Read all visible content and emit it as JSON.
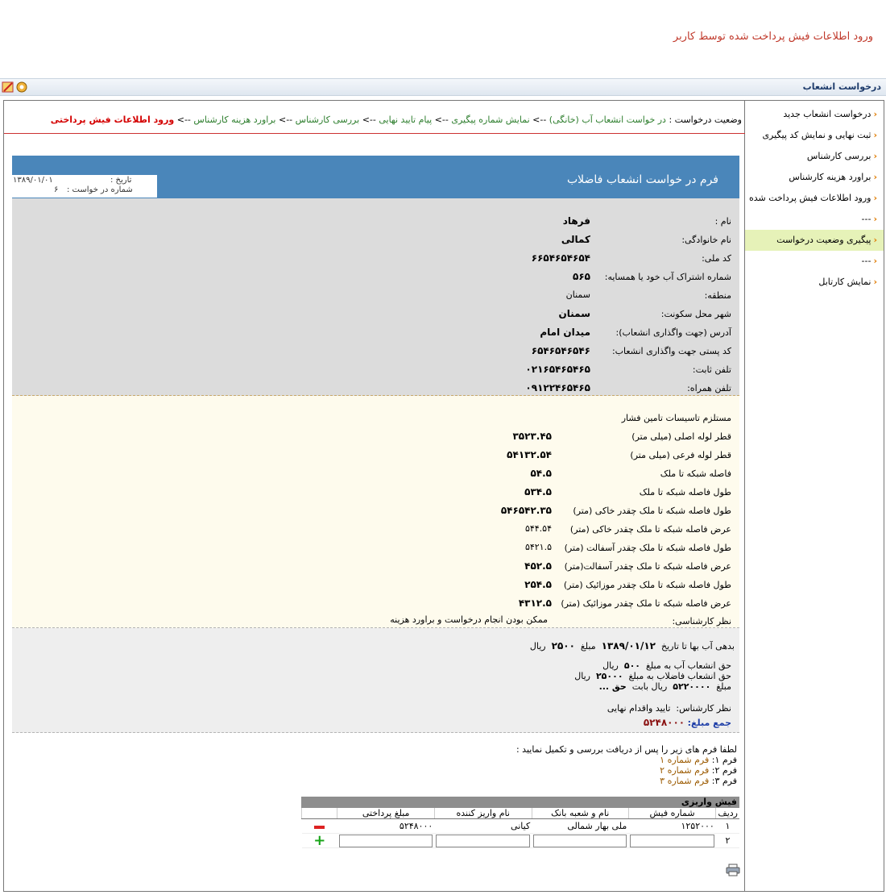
{
  "page_header": "ورود اطلاعات فیش پرداخت شده توسط کاربر",
  "title_bar": "درخواست انشعاب",
  "sidebar": [
    {
      "label": "درخواست انشعاب جدید",
      "active": false
    },
    {
      "label": "ثبت نهایی و نمایش کد پیگیری",
      "active": false
    },
    {
      "label": "بررسی کارشناس",
      "active": false
    },
    {
      "label": "براورد هزینه کارشناس",
      "active": false
    },
    {
      "label": "ورود اطلاعات فیش پرداخت شده",
      "active": false
    },
    {
      "label": "---",
      "active": false
    },
    {
      "label": "پیگیری وضعیت درخواست",
      "active": true
    },
    {
      "label": "---",
      "active": false
    },
    {
      "label": "نمایش کارتابل",
      "active": false
    }
  ],
  "status": {
    "prefix": "وضعیت درخواست :",
    "steps": [
      "در خواست انشعاب آب (خانگی)",
      "نمایش شماره پیگیری",
      "پیام تایید نهایی",
      "بررسی کارشناس",
      "براورد هزینه کارشناس"
    ],
    "separator": "-->",
    "current": "ورود اطلاعات فیش پرداختی"
  },
  "form": {
    "title": "فرم در خواست انشعاب فاضلاب",
    "date_label": "تاریخ :",
    "date_value": "۱۳۸۹/۰۱/۰۱",
    "request_no_label": "شماره در خواست :",
    "request_no_value": "۶"
  },
  "applicant": [
    {
      "label": "نام :",
      "value": "فرهاد",
      "bold": true
    },
    {
      "label": "نام خانوادگی:",
      "value": "کمالی",
      "bold": true
    },
    {
      "label": "کد ملی:",
      "value": "۶۶۵۴۶۵۴۶۵۴",
      "bold": true
    },
    {
      "label": "شماره اشتراک آب خود یا همسایه:",
      "value": "۵۶۵",
      "bold": true
    },
    {
      "label": "منطقه:",
      "value": "سمنان",
      "bold": false
    },
    {
      "label": "شهر محل سکونت:",
      "value": "سمنان",
      "bold": true
    },
    {
      "label": "آدرس (جهت واگذاری انشعاب):",
      "value": "میدان امام",
      "bold": true
    },
    {
      "label": "کد پستی جهت واگذاری انشعاب:",
      "value": "۶۵۴۶۵۴۶۵۴۶",
      "bold": true
    },
    {
      "label": "تلفن ثابت:",
      "value": "۰۲۱۶۵۴۶۵۴۶۵",
      "bold": true
    },
    {
      "label": "تلفن همراه:",
      "value": "۰۹۱۲۲۴۶۵۴۶۵",
      "bold": true
    }
  ],
  "expert_section": {
    "heading": "مستلزم تاسیسات تامین فشار",
    "rows": [
      {
        "label": "قطر لوله اصلی (میلی متر)",
        "value": "۳۵۲۳.۴۵",
        "bold": true
      },
      {
        "label": "قطر لوله فرعی (میلی متر)",
        "value": "۵۴۱۳۲.۵۴",
        "bold": true
      },
      {
        "label": "فاصله شبکه تا ملک",
        "value": "۵۴.۵",
        "bold": true
      },
      {
        "label": "طول فاصله شبکه تا ملک",
        "value": "۵۳۴.۵",
        "bold": true
      },
      {
        "label": "طول فاصله شبکه تا ملک چقدر خاکی (متر)",
        "value": "۵۴۶۵۴۲.۳۵",
        "bold": true
      },
      {
        "label": "عرض فاصله شبکه تا ملک چقدر خاکی (متر)",
        "value": "۵۴۴.۵۴",
        "bold": false
      },
      {
        "label": "طول فاصله شبکه تا ملک چقدر آسفالت  (متر)",
        "value": "۵۴۲۱.۵",
        "bold": false
      },
      {
        "label": "عرض فاصله شبکه تا ملک چقدر آسفالت(متر)",
        "value": "۴۵۲.۵",
        "bold": true
      },
      {
        "label": "طول فاصله شبکه تا ملک چقدر موزائیک  (متر)",
        "value": "۲۵۴.۵",
        "bold": true
      },
      {
        "label": "عرض فاصله شبکه تا ملک چقدر موزائیک (متر)",
        "value": "۴۳۱۲.۵",
        "bold": true
      }
    ],
    "opinion_label": "نظر کارشناسی:",
    "opinion_value": "ممکن بودن انجام درخواست و براورد هزینه"
  },
  "costs": {
    "debt_prefix": "بدهی آب بها تا تاریخ",
    "debt_date": "۱۳۸۹/۰۱/۱۲",
    "amount_word": "مبلغ",
    "debt_amount": "۲۵۰۰",
    "rial": "ریال",
    "water_label": "حق انشعاب آب به مبلغ",
    "water_amount": "۵۰۰",
    "sewer_label": "حق انشعاب فاضلاب به مبلغ",
    "sewer_amount": "۲۵۰۰۰",
    "other_amount": "۵۲۲۰۰۰۰",
    "other_label": "ریال بابت",
    "other_item": "حق ...",
    "final_label": "نظر کارشناس:",
    "final_value": "تایید واقدام نهایی",
    "total_label": "جمع مبلغ:",
    "total_value": "۵۲۴۸۰۰۰"
  },
  "instructions": {
    "text": "لطفا فرم های زیر را پس از دریافت بررسی و تکمیل نمایید  :",
    "forms": [
      {
        "label": "فرم ۱:",
        "link": "فرم شماره ۱"
      },
      {
        "label": "فرم ۲:",
        "link": "فرم شماره ۲"
      },
      {
        "label": "فرم ۳:",
        "link": "فرم شماره ۳"
      }
    ]
  },
  "receipt": {
    "title": "فیش واریزی",
    "columns": [
      "ردیف",
      "شماره فیش",
      "نام و شعبه بانک",
      "نام واریز کننده",
      "مبلغ پرداختی"
    ],
    "rows": [
      {
        "no": "۱",
        "receipt_no": "۱۲۵۲۰۰۰",
        "bank": "ملی بهار شمالی",
        "payer": "کیانی",
        "amount": "۵۲۴۸۰۰۰"
      },
      {
        "no": "۲",
        "receipt_no": "",
        "bank": "",
        "payer": "",
        "amount": ""
      }
    ]
  },
  "icons": {
    "sidebar_arrow": "chevron-left-icon",
    "print": "printer-icon",
    "remove": "minus-icon",
    "add": "plus-icon"
  }
}
